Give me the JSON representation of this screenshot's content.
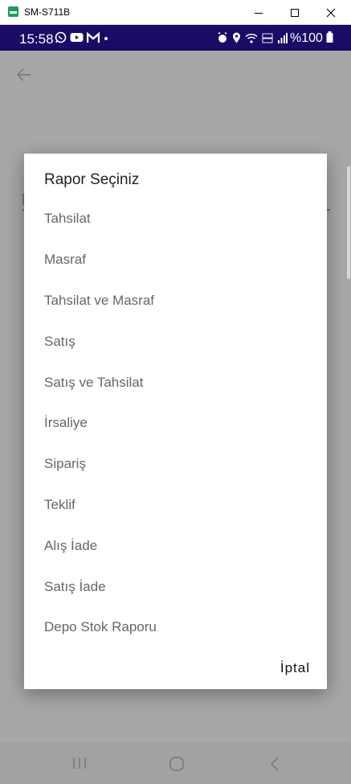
{
  "window": {
    "title": "SM-S711B"
  },
  "statusbar": {
    "time": "15:58",
    "battery": "%100",
    "notification_icons": [
      "whatsapp-icon",
      "youtube-icon",
      "gmail-icon",
      "dot-icon"
    ],
    "system_icons": [
      "alarm-icon",
      "location-icon",
      "wifi-icon",
      "volte-icon",
      "signal-icon",
      "battery-icon"
    ]
  },
  "dialog": {
    "title": "Rapor Seçiniz",
    "items": [
      "Tahsilat",
      "Masraf",
      "Tahsilat ve Masraf",
      "Satış",
      "Satış ve Tahsilat",
      "İrsaliye",
      "Sipariş",
      "Teklif",
      "Alış İade",
      "Satış İade",
      "Depo Stok Raporu"
    ],
    "cancel_label": "İptal"
  },
  "navbar": {
    "buttons": [
      "recents-icon",
      "home-icon",
      "back-icon"
    ]
  },
  "colors": {
    "statusbar": "#1b0a66",
    "scrim": "#a6a6a6",
    "dialog_bg": "#ffffff",
    "item_text": "#666666"
  }
}
